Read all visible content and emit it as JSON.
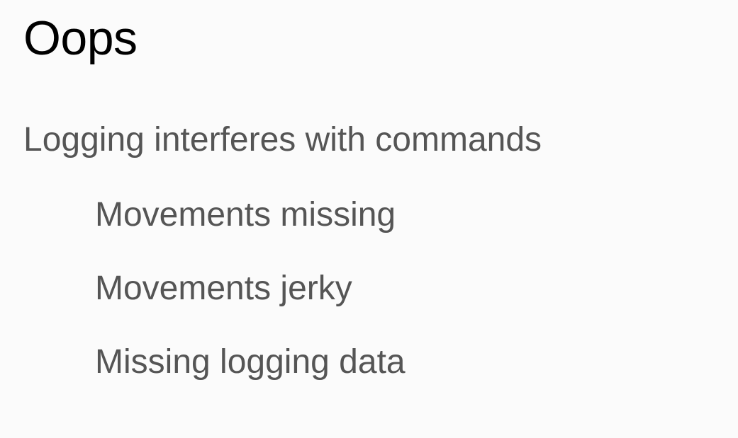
{
  "slide": {
    "title": "Oops",
    "bullets": [
      {
        "text": "Logging interferes with commands",
        "level": 1
      },
      {
        "text": "Movements missing",
        "level": 2
      },
      {
        "text": "Movements jerky",
        "level": 2
      },
      {
        "text": "Missing logging data",
        "level": 2
      }
    ]
  },
  "colors": {
    "background": "#fbfbfb",
    "title": "#000000",
    "body_text": "#555555"
  }
}
